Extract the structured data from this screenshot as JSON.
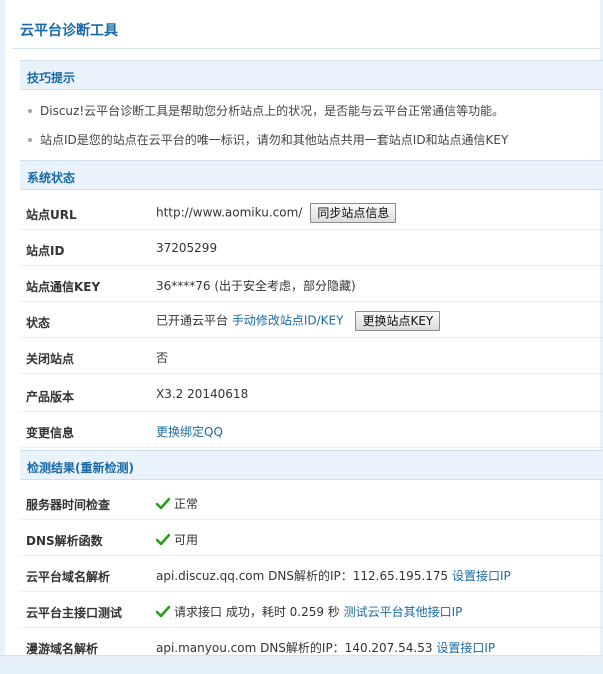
{
  "title": "云平台诊断工具",
  "sections": {
    "tips": "技巧提示",
    "system": "系统状态",
    "checks_prefix": "检测结果(",
    "checks_link": "重新检测",
    "checks_suffix": ")"
  },
  "tips": [
    "Discuz!云平台诊断工具是帮助您分析站点上的状况，是否能与云平台正常通信等功能。",
    "站点ID是您的站点在云平台的唯一标识，请勿和其他站点共用一套站点ID和站点通信KEY"
  ],
  "system": {
    "site_url_label": "站点URL",
    "site_url_value": "http://www.aomiku.com/",
    "sync_button": "同步站点信息",
    "site_id_label": "站点ID",
    "site_id_value": "37205299",
    "site_key_label": "站点通信KEY",
    "site_key_value": "36****76 (出于安全考虑，部分隐藏)",
    "status_label": "状态",
    "status_value": "已开通云平台",
    "status_link": "手动修改站点ID/KEY",
    "change_key_button": "更换站点KEY",
    "closed_label": "关闭站点",
    "closed_value": "否",
    "version_label": "产品版本",
    "version_value": "X3.2 20140618",
    "change_label": "变更信息",
    "change_link": "更换绑定QQ"
  },
  "checks": {
    "server_time_label": "服务器时间检查",
    "server_time_value": "正常",
    "dns_label": "DNS解析函数",
    "dns_value": "可用",
    "cloud_domain_label": "云平台域名解析",
    "cloud_domain_value": "api.discuz.qq.com DNS解析的IP：112.65.195.175",
    "cloud_domain_link": "设置接口IP",
    "main_api_label": "云平台主接口测试",
    "main_api_value": "请求接口 成功，耗时 0.259 秒",
    "main_api_link": "测试云平台其他接口IP",
    "manyou_label": "漫游域名解析",
    "manyou_value": "api.manyou.com DNS解析的IP：140.207.54.53",
    "manyou_link": "设置接口IP"
  },
  "colors": {
    "accent": "#1a6aa7",
    "section_bg": "#eaf3fb",
    "ok_green": "#2e9b1f"
  },
  "icons": [
    "check-icon"
  ]
}
